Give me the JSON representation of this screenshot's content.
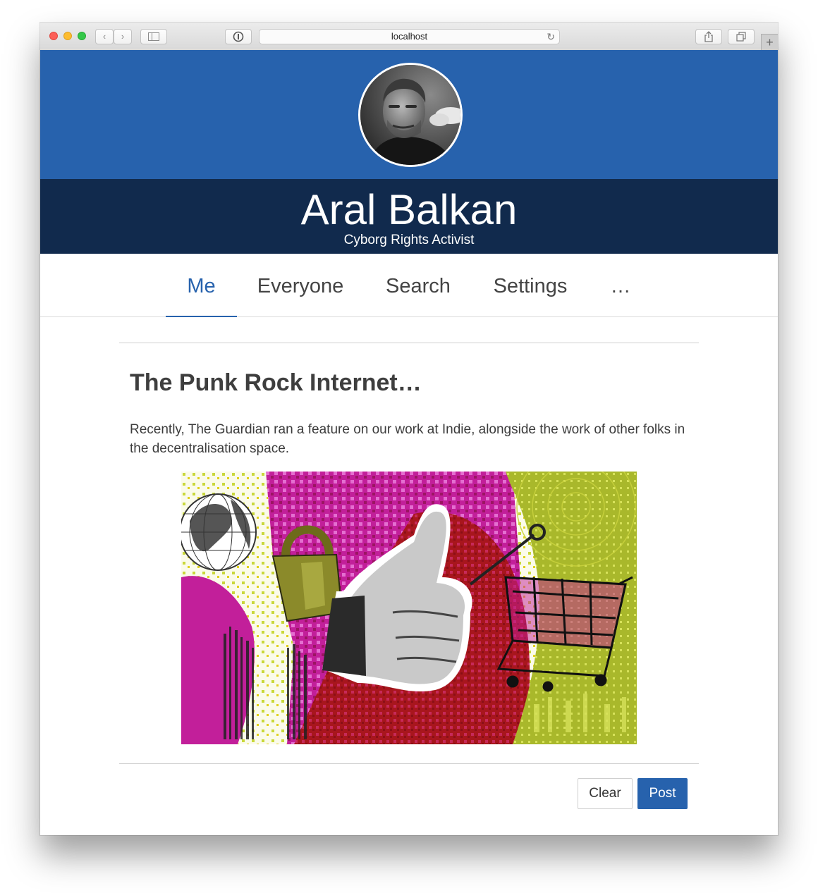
{
  "browser": {
    "url": "localhost"
  },
  "profile": {
    "name": "Aral Balkan",
    "tagline": "Cyborg Rights Activist"
  },
  "nav": {
    "items": [
      "Me",
      "Everyone",
      "Search",
      "Settings",
      "…"
    ],
    "active": "Me"
  },
  "post": {
    "title": "The Punk Rock Internet…",
    "body": "Recently, The Guardian ran a feature on our work at Indie, alongside the work of other folks in the decentralisation space."
  },
  "actions": {
    "clear_label": "Clear",
    "post_label": "Post"
  },
  "colors": {
    "brand_blue": "#2762ad",
    "navy": "#112a4d"
  }
}
